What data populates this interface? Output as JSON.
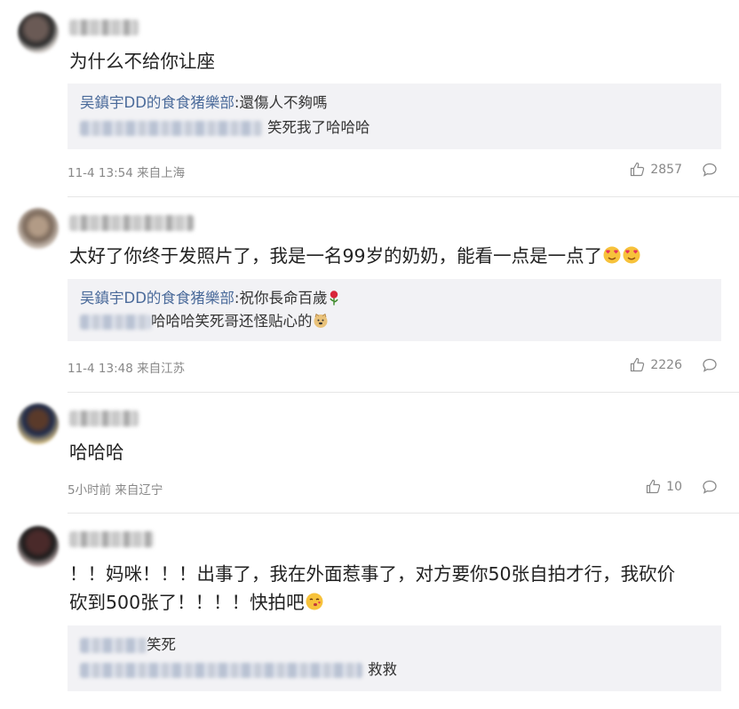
{
  "comments": [
    {
      "text": "为什么不给你让座",
      "reply_author": "吴鎮宇DD的食食猪樂部",
      "reply_text": ":還傷人不夠嗎",
      "subreply_text": "笑死我了哈哈哈",
      "time": "11-4 13:54",
      "location": "来自上海",
      "likes": "2857"
    },
    {
      "text": "太好了你终于发照片了，我是一名99岁的奶奶，能看一点是一点了",
      "reply_author": "吴鎮宇DD的食食猪樂部",
      "reply_text": ":祝你長命百歲",
      "subreply_text": "哈哈哈笑死哥还怪贴心的",
      "time": "11-4 13:48",
      "location": "来自江苏",
      "likes": "2226"
    },
    {
      "text": "哈哈哈",
      "time": "5小时前",
      "location": "来自辽宁",
      "likes": "10"
    },
    {
      "text_line1": "！！妈咪！！！出事了，我在外面惹事了，对方要你50张自拍才行，我砍价",
      "text_line2": "砍到500张了！！！！快拍吧",
      "reply_text": "笑死",
      "subreply_text": "救救"
    }
  ],
  "icons": {
    "like": "thumbs-up-icon",
    "reply": "comment-bubble-icon",
    "heart_eyes": "heart-eyes-emoji-icon",
    "rose": "rose-emoji-icon",
    "doge": "doge-emoji-icon",
    "kiss": "kiss-emoji-icon"
  },
  "colors": {
    "author": "#4a6a9a",
    "reply_bg": "#f2f2f5",
    "meta": "#888888"
  }
}
